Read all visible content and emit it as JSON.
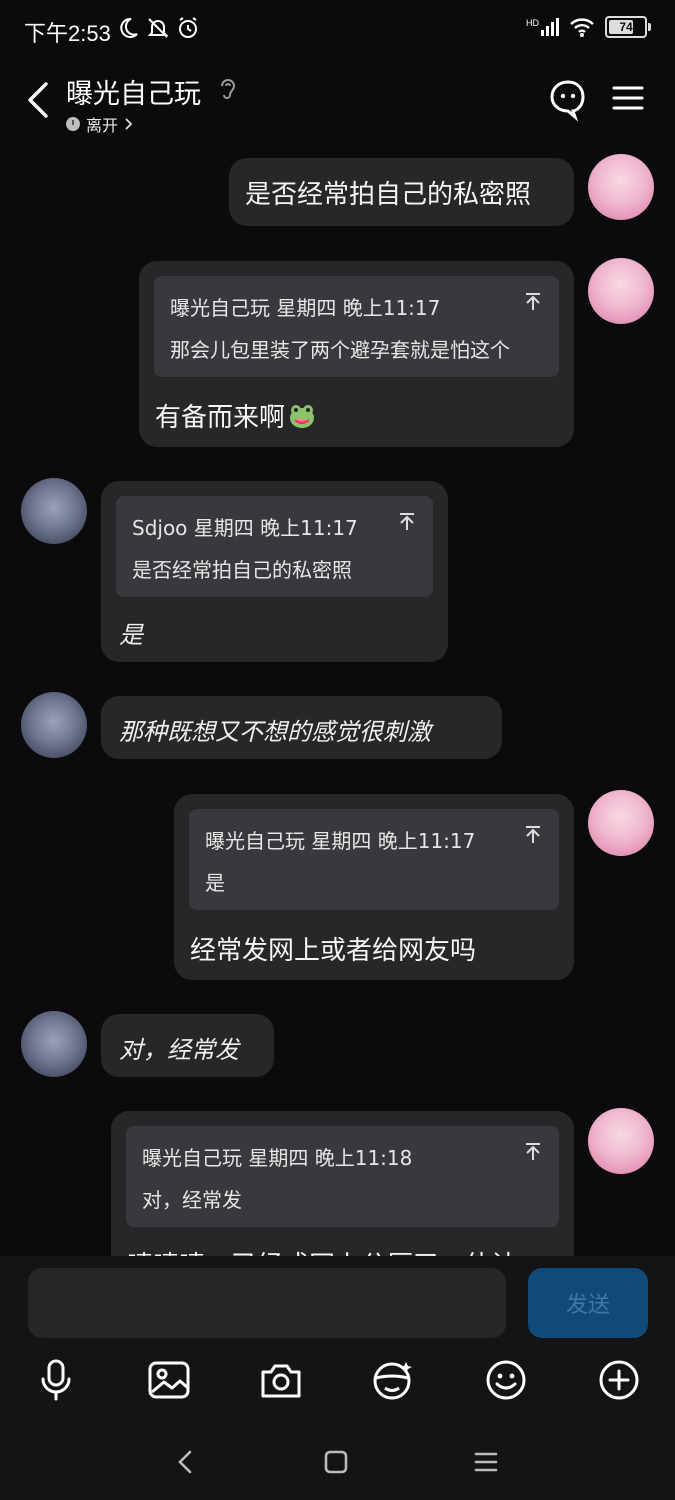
{
  "status_bar": {
    "time": "下午2:53",
    "network": "HD",
    "battery": "74",
    "battery_level": 0.74
  },
  "header": {
    "title": "曝光自己玩",
    "presence": "离开"
  },
  "messages": [
    {
      "id": "m1",
      "side": "right",
      "text": "是否经常拍自己的私密照"
    },
    {
      "id": "m2",
      "side": "right",
      "quote_sender": "曝光自己玩",
      "quote_time": "星期四 晚上11:17",
      "quote_text": "那会儿包里装了两个避孕套就是怕这个",
      "text": "有备而来啊",
      "emoji": "frog-emoji"
    },
    {
      "id": "m3",
      "side": "left",
      "quote_sender": "Sdjoo",
      "quote_time": "星期四 晚上11:17",
      "quote_text": "是否经常拍自己的私密照",
      "text": "是"
    },
    {
      "id": "m4",
      "side": "left",
      "text": "那种既想又不想的感觉很刺激"
    },
    {
      "id": "m5",
      "side": "right",
      "quote_sender": "曝光自己玩",
      "quote_time": "星期四 晚上11:17",
      "quote_text": "是",
      "text": "经常发网上或者给网友吗"
    },
    {
      "id": "m6",
      "side": "left",
      "text": "对，经常发"
    },
    {
      "id": "m7",
      "side": "right",
      "quote_sender": "曝光自己玩",
      "quote_time": "星期四 晚上11:18",
      "quote_text": "对，经常发",
      "text": "啧啧啧，已经成网上公厕了，估计"
    }
  ],
  "composer": {
    "placeholder": "",
    "send_label": "发送"
  },
  "toolbar": [
    "microphone-icon",
    "image-icon",
    "camera-icon",
    "sticker-icon",
    "emoji-icon",
    "plus-icon"
  ],
  "colors": {
    "background": "#0b0b0d",
    "bubble": "#27272a",
    "quote": "#39393d",
    "send": "#0f4a7a"
  }
}
